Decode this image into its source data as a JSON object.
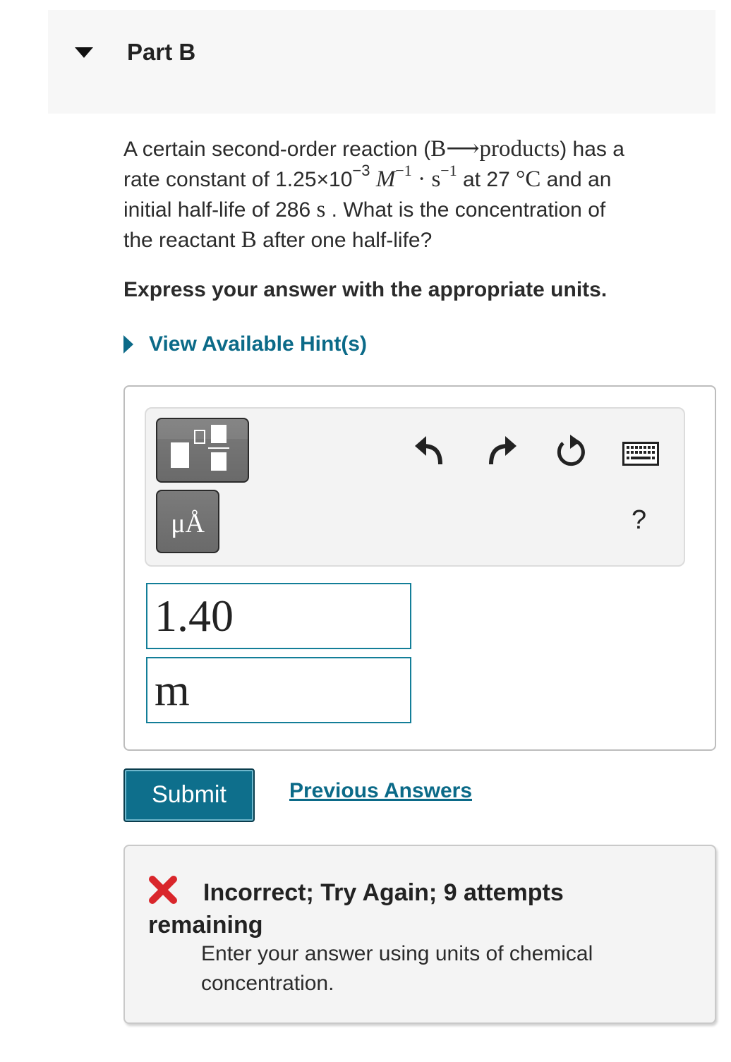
{
  "part": {
    "title": "Part B"
  },
  "problem": {
    "line1_a": "A certain second-order reaction (",
    "reaction": "B⟶products",
    "line1_b": ") has a",
    "line2_a": "rate constant of 1.25×10",
    "exp1": "−3",
    "unit_M": "M",
    "exp2": "−1",
    "dot": "·",
    "unit_s": "s",
    "exp3": "−1",
    "at": " at 27 ",
    "deg": "°C",
    "line2_b": " and an",
    "line3_a": "initial half-life of 286 ",
    "unit_s2": "s",
    "line3_b": " . What is the concentration of",
    "line4_a": "the reactant ",
    "species": "B",
    "line4_b": " after one half-life?"
  },
  "instruction": "Express your answer with the appropriate units.",
  "hint": {
    "label": "View Available Hint(s)"
  },
  "toolbar": {
    "unit_symbol": "μÅ",
    "help": "?",
    "icons": [
      "templates-icon",
      "units-icon",
      "undo-icon",
      "redo-icon",
      "reset-icon",
      "keyboard-icon",
      "help-icon"
    ]
  },
  "answer": {
    "value": "1.40",
    "unit": "m"
  },
  "actions": {
    "submit": "Submit",
    "previous": "Previous Answers"
  },
  "feedback": {
    "status": "Incorrect; Try Again; 9 attempts remaining",
    "message": "Enter your answer using units of chemical concentration.",
    "icon_color": "#d9262b"
  },
  "colors": {
    "accent": "#0e6f8c",
    "link": "#0b6a88"
  }
}
